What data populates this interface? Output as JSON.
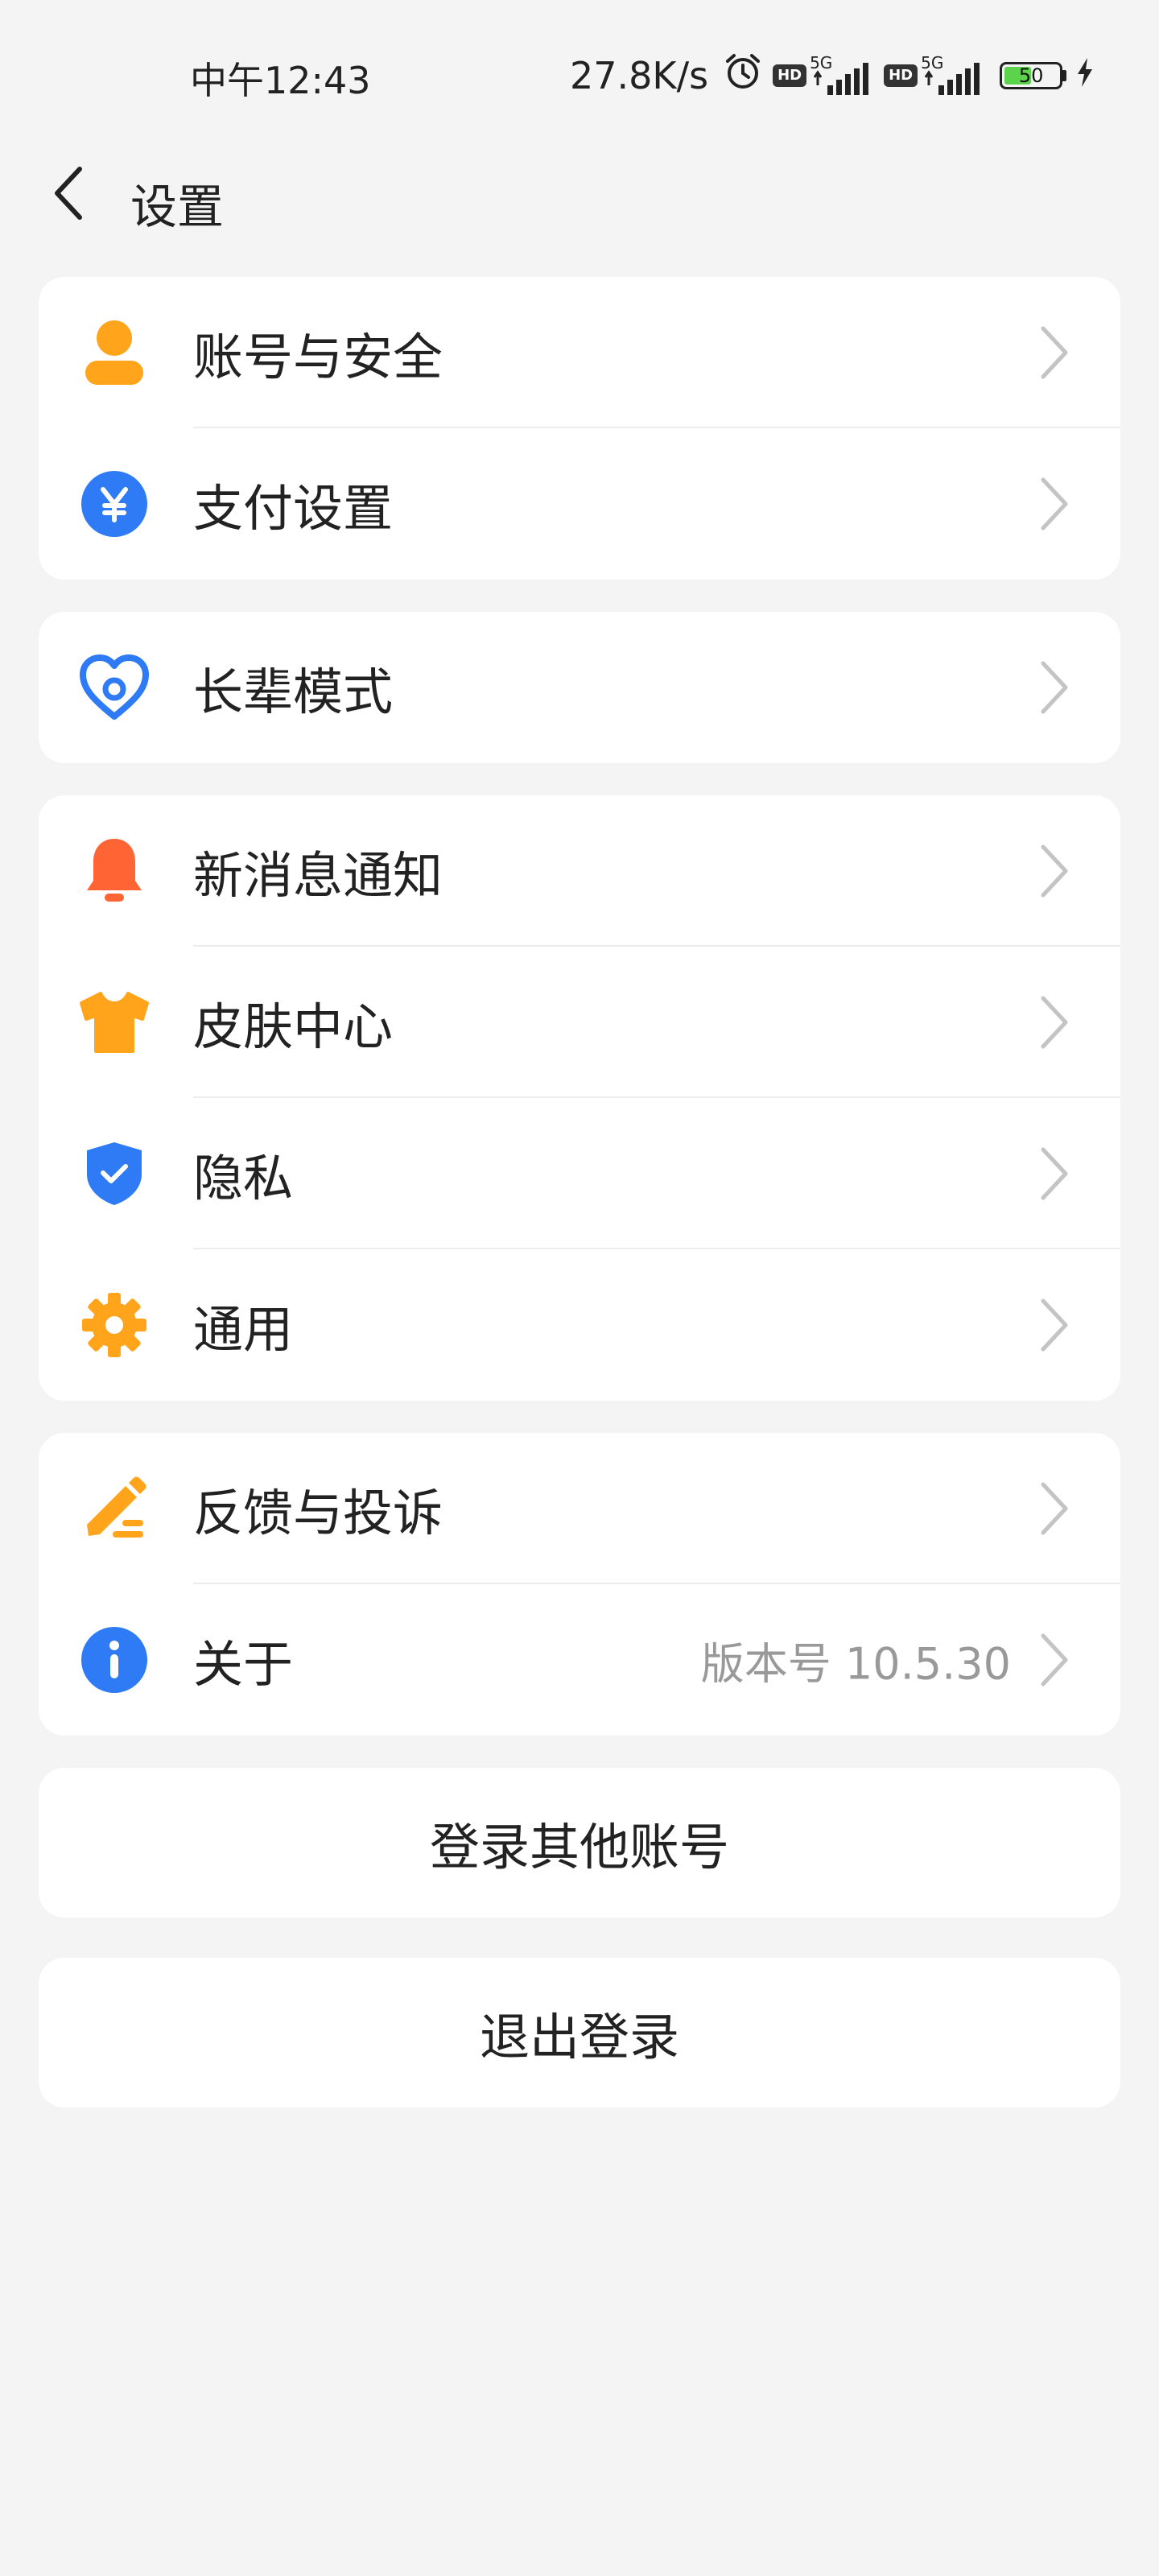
{
  "status_bar": {
    "time": "中午12:43",
    "net_speed": "27.8K/s",
    "alarm_icon": "alarm-icon",
    "hd1": "HD",
    "sig1_type": "5G",
    "hd2": "HD",
    "sig2_type": "5G",
    "battery_level": "50",
    "battery_fraction": 0.5,
    "charging_icon": "bolt-icon"
  },
  "header": {
    "back_icon": "chevron-left-icon",
    "title": "设置"
  },
  "groups": [
    {
      "items": [
        {
          "label": "账号与安全",
          "icon": "user-icon",
          "icon_color": "#FFA41B"
        },
        {
          "label": "支付设置",
          "icon": "yuan-icon",
          "icon_color": "#2F7BF5"
        }
      ]
    },
    {
      "items": [
        {
          "label": "长辈模式",
          "icon": "heart-icon",
          "icon_color": "#2F7BF5"
        }
      ]
    },
    {
      "items": [
        {
          "label": "新消息通知",
          "icon": "bell-icon",
          "icon_color": "#FF6434"
        },
        {
          "label": "皮肤中心",
          "icon": "tshirt-icon",
          "icon_color": "#FFA41B"
        },
        {
          "label": "隐私",
          "icon": "shield-check-icon",
          "icon_color": "#2F7BF5"
        },
        {
          "label": "通用",
          "icon": "gear-icon",
          "icon_color": "#FFA41B"
        }
      ]
    },
    {
      "items": [
        {
          "label": "反馈与投诉",
          "icon": "pencil-icon",
          "icon_color": "#FFA41B"
        },
        {
          "label": "关于",
          "icon": "info-icon",
          "icon_color": "#2F7BF5",
          "value": "版本号 10.5.30"
        }
      ]
    }
  ],
  "buttons": {
    "switch_account": "登录其他账号",
    "logout": "退出登录"
  },
  "colors": {
    "background": "#F4F4F4",
    "card": "#FFFFFF",
    "text": "#222222",
    "secondary": "#999999",
    "chevron": "#C4C4C4"
  }
}
